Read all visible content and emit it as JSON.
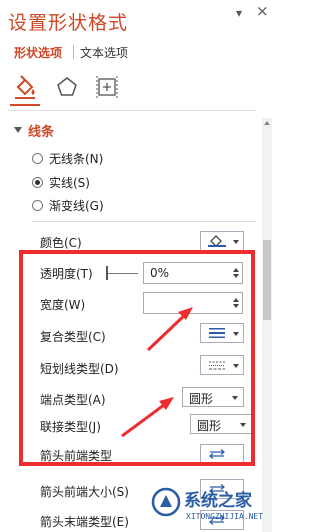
{
  "pane": {
    "title": "设置形状格式",
    "pin_glyph": "▾",
    "close_glyph": "×"
  },
  "tabs": [
    {
      "label": "形状选项",
      "active": true
    },
    {
      "label": "文本选项",
      "active": false
    }
  ],
  "category_icons": [
    "fill-line-icon",
    "effects-pentagon-icon",
    "size-properties-icon"
  ],
  "section": {
    "title": "线条",
    "expanded": true
  },
  "line_types": [
    {
      "label": "无线条(N)",
      "selected": false
    },
    {
      "label": "实线(S)",
      "selected": true
    },
    {
      "label": "渐变线(G)",
      "selected": false
    }
  ],
  "properties": {
    "color": {
      "label": "颜色(C)"
    },
    "transparency": {
      "label": "透明度(T)",
      "value": "0%"
    },
    "width": {
      "label": "宽度(W)",
      "value": ""
    },
    "compound_type": {
      "label": "复合类型(C)"
    },
    "dash_type": {
      "label": "短划线类型(D)"
    },
    "cap_type": {
      "label": "端点类型(A)",
      "value": "圆形"
    },
    "join_type": {
      "label": "联接类型(J)",
      "value": "圆形"
    },
    "begin_arrow_type": {
      "label": "箭头前端类型"
    },
    "begin_arrow_size": {
      "label": "箭头前端大小(S)"
    },
    "end_arrow_type": {
      "label": "箭头末端类型(E)"
    }
  },
  "watermark": {
    "text": "系统之家",
    "url": "XITONGZHIJIA.NET"
  },
  "colors": {
    "accent": "#d24726",
    "highlight_box": "#ee2c2c"
  }
}
